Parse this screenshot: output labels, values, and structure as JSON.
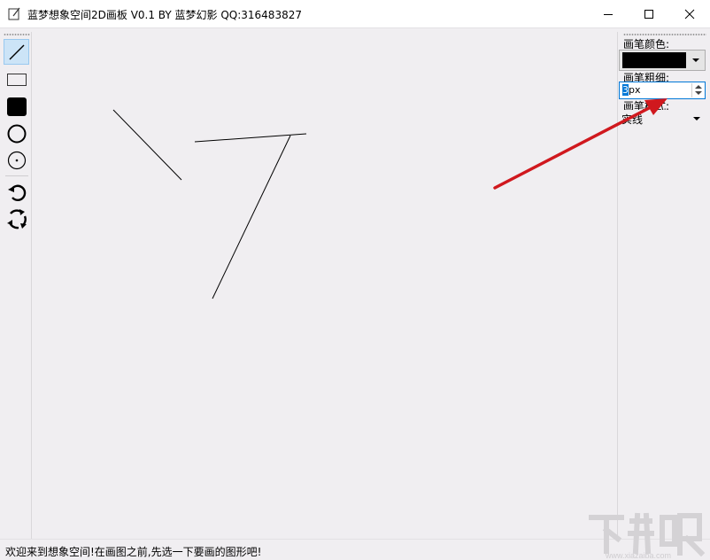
{
  "window": {
    "title": "蓝梦想象空间2D画板 V0.1 BY 蓝梦幻影 QQ:316483827",
    "app_icon": "notepad-icon",
    "controls": [
      "minimize-icon",
      "maximize-icon",
      "close-icon"
    ]
  },
  "toolbar": {
    "tools": [
      {
        "name": "line-tool",
        "icon": "line-icon",
        "selected": true
      },
      {
        "name": "rectangle-tool",
        "icon": "rectangle-icon",
        "selected": false
      },
      {
        "name": "filled-rectangle-tool",
        "icon": "filled-rectangle-icon",
        "selected": false
      },
      {
        "name": "ellipse-tool",
        "icon": "circle-icon",
        "selected": false
      },
      {
        "name": "circle-center-tool",
        "icon": "circle-dot-icon",
        "selected": false
      },
      {
        "name": "undo-tool",
        "icon": "undo-icon",
        "selected": false
      },
      {
        "name": "redo-tool",
        "icon": "redo-icon",
        "selected": false
      }
    ]
  },
  "panel": {
    "pen_color_label": "画笔颜色:",
    "pen_color_value": "#000000",
    "pen_width_label": "画笔粗细:",
    "pen_width_value": "3",
    "pen_width_unit": "px",
    "pen_style_label": "画笔样式:",
    "pen_style_value": "实线"
  },
  "status": {
    "message": "欢迎来到想象空间!在画图之前,先选一下要画的图形吧!"
  },
  "colors": {
    "selection_fill": "#cce4f7",
    "selection_border": "#99c9ef",
    "focus_border": "#0078d7",
    "annotation_arrow": "#d0181e"
  },
  "watermark": {
    "text": "下载吧",
    "url": "www.xiazaiba.com"
  }
}
